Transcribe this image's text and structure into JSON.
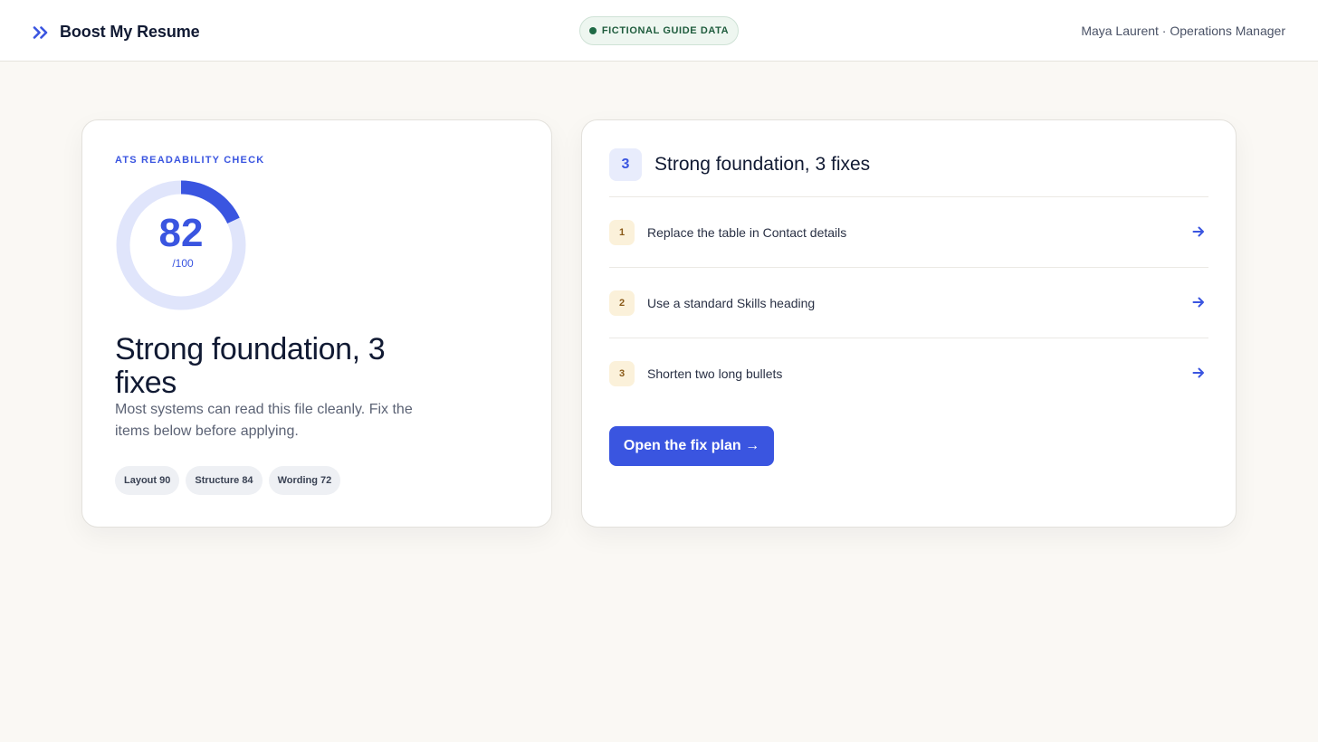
{
  "header": {
    "brand_name": "Boost My Resume",
    "badge_label": "FICTIONAL GUIDE DATA",
    "user_line": "Maya Laurent · Operations Manager"
  },
  "score_card": {
    "eyebrow": "ATS READABILITY CHECK",
    "score": "82",
    "score_max": "/100",
    "score_fraction": 0.82,
    "headline": "Strong foundation, 3 fixes",
    "description": "Most systems can read this file cleanly. Fix the items below before applying.",
    "chips": [
      {
        "label": "Layout 90"
      },
      {
        "label": "Structure 84"
      },
      {
        "label": "Wording 72"
      }
    ]
  },
  "fixes_card": {
    "count": "3",
    "title": "Strong foundation, 3 fixes",
    "items": [
      {
        "num": "1",
        "label": "Replace the table in Contact details"
      },
      {
        "num": "2",
        "label": "Use a standard Skills heading"
      },
      {
        "num": "3",
        "label": "Shorten two long bullets"
      }
    ],
    "cta_label": "Open the fix plan →"
  },
  "colors": {
    "accent": "#3a55e0",
    "accent_soft": "#e0e5fb",
    "badge_green": "#1f6a45",
    "background": "#faf8f4"
  },
  "icons": {
    "brand": "double-chevron-right-icon",
    "badge": "status-dot-icon",
    "row_action": "arrow-right-icon"
  }
}
